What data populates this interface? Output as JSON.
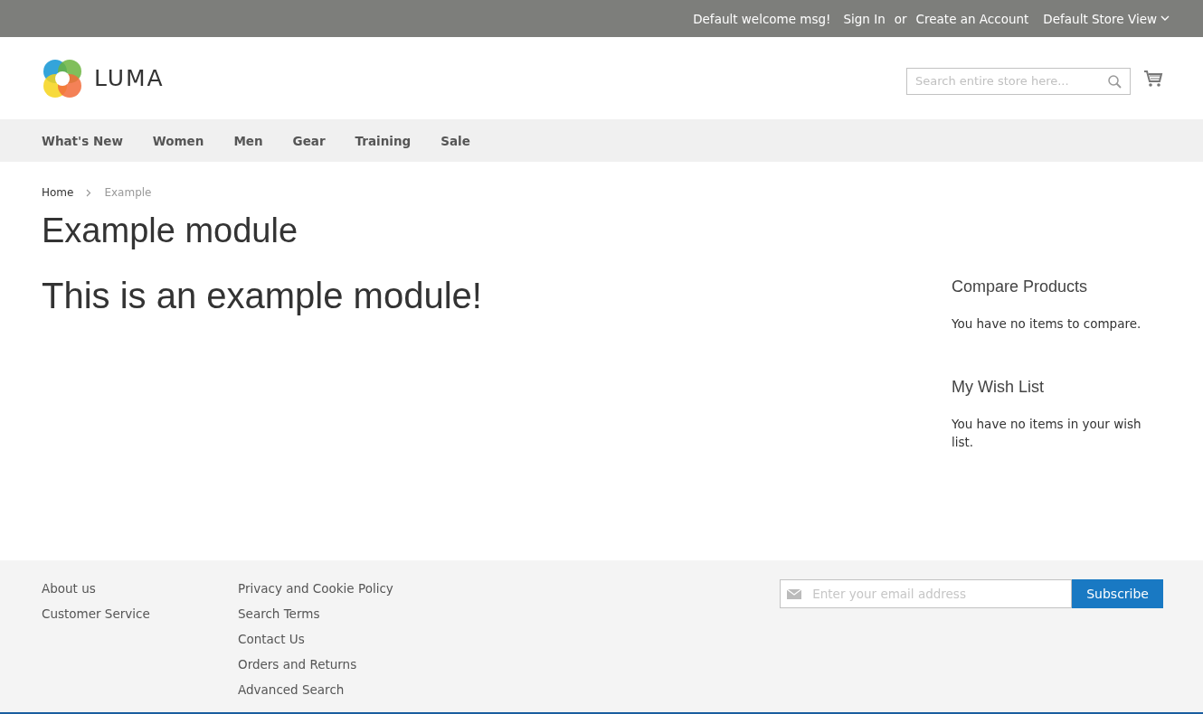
{
  "top_bar": {
    "welcome": "Default welcome msg!",
    "sign_in": "Sign In",
    "or": "or",
    "create_account": "Create an Account",
    "store_view": "Default Store View"
  },
  "header": {
    "logo_text": "LUMA",
    "search": {
      "placeholder": "Search entire store here..."
    }
  },
  "nav": [
    {
      "label": "What's New"
    },
    {
      "label": "Women"
    },
    {
      "label": "Men"
    },
    {
      "label": "Gear"
    },
    {
      "label": "Training"
    },
    {
      "label": "Sale"
    }
  ],
  "breadcrumbs": [
    {
      "label": "Home",
      "link": true
    },
    {
      "label": "Example",
      "link": false
    }
  ],
  "page_title": "Example module",
  "content": "This is an example module!",
  "sidebar": [
    {
      "title": "Compare Products",
      "text": "You have no items to compare."
    },
    {
      "title": "My Wish List",
      "text": "You have no items in your wish list."
    }
  ],
  "footer": {
    "columns": [
      [
        "About us",
        "Customer Service"
      ],
      [
        "Privacy and Cookie Policy",
        "Search Terms",
        "Contact Us",
        "Orders and Returns",
        "Advanced Search"
      ]
    ],
    "newsletter": {
      "placeholder": "Enter your email address",
      "button": "Subscribe"
    }
  }
}
